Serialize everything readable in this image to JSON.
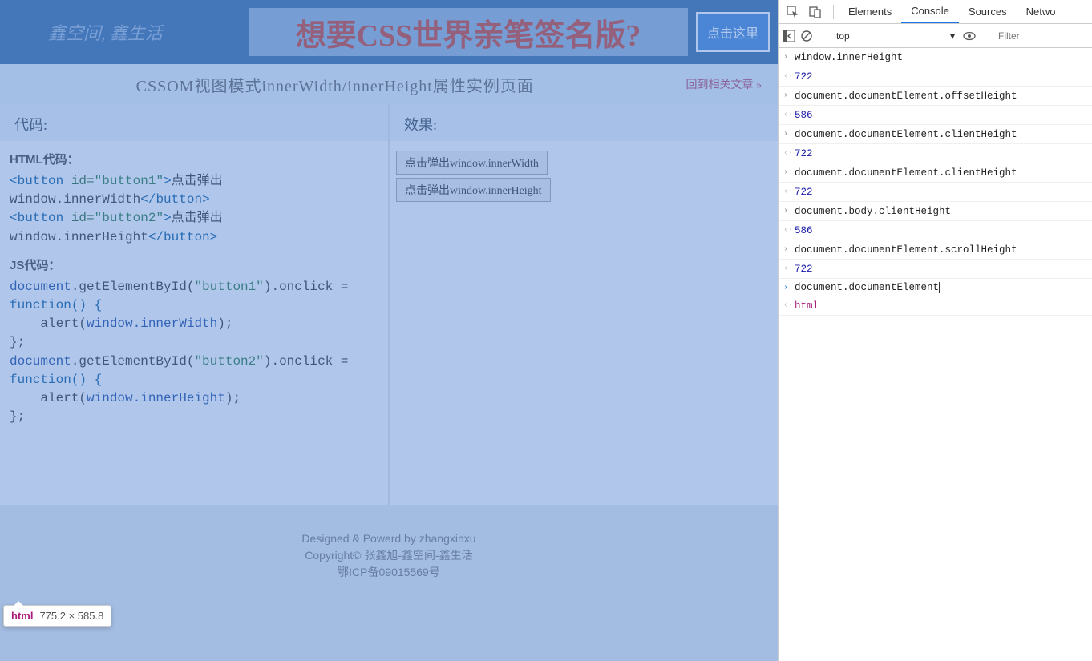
{
  "page": {
    "logo": "鑫空间, 鑫生活",
    "banner_text": "想要CSS世界亲笔签名版?",
    "cta_label": "点击这里",
    "subheader_title": "CSSOM视图模式innerWidth/innerHeight属性实例页面",
    "back_link": "回到相关文章 »",
    "panels": {
      "code_title": "代码:",
      "effect_title": "效果:",
      "html_label": "HTML代码：",
      "js_label": "JS代码：",
      "html_code": {
        "btn1_id": "\"button1\"",
        "btn1_text": "点击弹出window.innerWidth",
        "btn2_id": "\"button2\"",
        "btn2_text": "点击弹出window.innerHeight"
      },
      "js_code": {
        "l1a": "document",
        "l1b": ".getElementById(",
        "l1c": "\"button1\"",
        "l1d": ").onclick = ",
        "l2": "function() {",
        "l3a": "    alert(",
        "l3b": "window.innerWidth",
        "l3c": ");",
        "l4": "};",
        "l5a": "document",
        "l5b": ".getElementById(",
        "l5c": "\"button2\"",
        "l5d": ").onclick = ",
        "l6": "function() {",
        "l7a": "    alert(",
        "l7b": "window.innerHeight",
        "l7c": ");",
        "l8": "};"
      },
      "demo_btn1": "点击弹出window.innerWidth",
      "demo_btn2": "点击弹出window.innerHeight"
    },
    "footer": {
      "line1a": "Designed & Powerd by ",
      "line1b": "zhangxinxu",
      "line2": "Copyright© 张鑫旭-鑫空间-鑫生活",
      "line3": "鄂ICP备09015569号"
    },
    "tooltip": {
      "tag": "html",
      "dims": "775.2 × 585.8"
    }
  },
  "devtools": {
    "tabs": [
      "Elements",
      "Console",
      "Sources",
      "Netwo"
    ],
    "active_tab": 1,
    "context_selector": "top",
    "filter_placeholder": "Filter",
    "console": [
      {
        "t": "in",
        "v": "window.innerHeight"
      },
      {
        "t": "out",
        "v": "722",
        "k": "num"
      },
      {
        "t": "in",
        "v": "document.documentElement.offsetHeight"
      },
      {
        "t": "out",
        "v": "586",
        "k": "num"
      },
      {
        "t": "in",
        "v": "document.documentElement.clientHeight"
      },
      {
        "t": "out",
        "v": "722",
        "k": "num"
      },
      {
        "t": "in",
        "v": "document.documentElement.clientHeight"
      },
      {
        "t": "out",
        "v": "722",
        "k": "num"
      },
      {
        "t": "in",
        "v": "document.body.clientHeight"
      },
      {
        "t": "out",
        "v": "586",
        "k": "num"
      },
      {
        "t": "in",
        "v": "document.documentElement.scrollHeight"
      },
      {
        "t": "out",
        "v": "722",
        "k": "num"
      }
    ],
    "current_input": "document.documentElement",
    "current_output": "html"
  }
}
